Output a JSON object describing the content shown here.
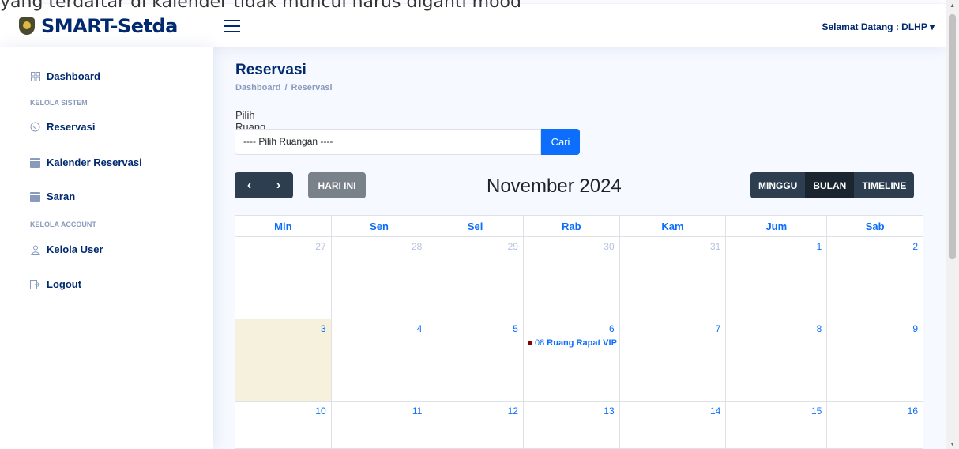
{
  "topbar": {
    "overlay_text": "yang terdaftar di kalender tidak muncul harus diganti mood"
  },
  "header": {
    "app_name": "SMART-Setda",
    "welcome": "Selamat Datang : DLHP",
    "welcome_caret": "▾"
  },
  "sidebar": {
    "items": [
      {
        "label": "Dashboard",
        "icon": "grid-icon"
      },
      {
        "label": "KELOLA SISTEM",
        "heading": true
      },
      {
        "label": "Reservasi",
        "icon": "whatsapp-icon"
      },
      {
        "label": "Kalender Reservasi",
        "icon": "calendar-icon"
      },
      {
        "label": "Saran",
        "icon": "calendar-icon"
      },
      {
        "label": "KELOLA ACCOUNT",
        "heading": true
      },
      {
        "label": "Kelola User",
        "icon": "user-icon"
      },
      {
        "label": "Logout",
        "icon": "logout-icon"
      }
    ]
  },
  "page": {
    "title": "Reservasi",
    "breadcrumb": [
      "Dashboard",
      "Reservasi"
    ],
    "breadcrumb_sep": "/",
    "room_label": "Pilih Ruang",
    "room_select_value": "---- Pilih Ruangan ----",
    "search_button": "Cari"
  },
  "calendar": {
    "prev_icon": "‹",
    "next_icon": "›",
    "today_button": "HARI INI",
    "title": "November 2024",
    "views": [
      "MINGGU",
      "BULAN",
      "TIMELINE"
    ],
    "active_view": "BULAN",
    "weekdays": [
      "Min",
      "Sen",
      "Sel",
      "Rab",
      "Kam",
      "Jum",
      "Sab"
    ],
    "weeks": [
      [
        "27",
        "28",
        "29",
        "30",
        "31",
        "1",
        "2"
      ],
      [
        "3",
        "4",
        "5",
        "6",
        "7",
        "8",
        "9"
      ],
      [
        "10",
        "11",
        "12",
        "13",
        "14",
        "15",
        "16"
      ]
    ],
    "today": "3",
    "event": {
      "day": "6",
      "time": "08",
      "title": "Ruang Rapat VIP",
      "dot_color": "#8b0000"
    }
  }
}
